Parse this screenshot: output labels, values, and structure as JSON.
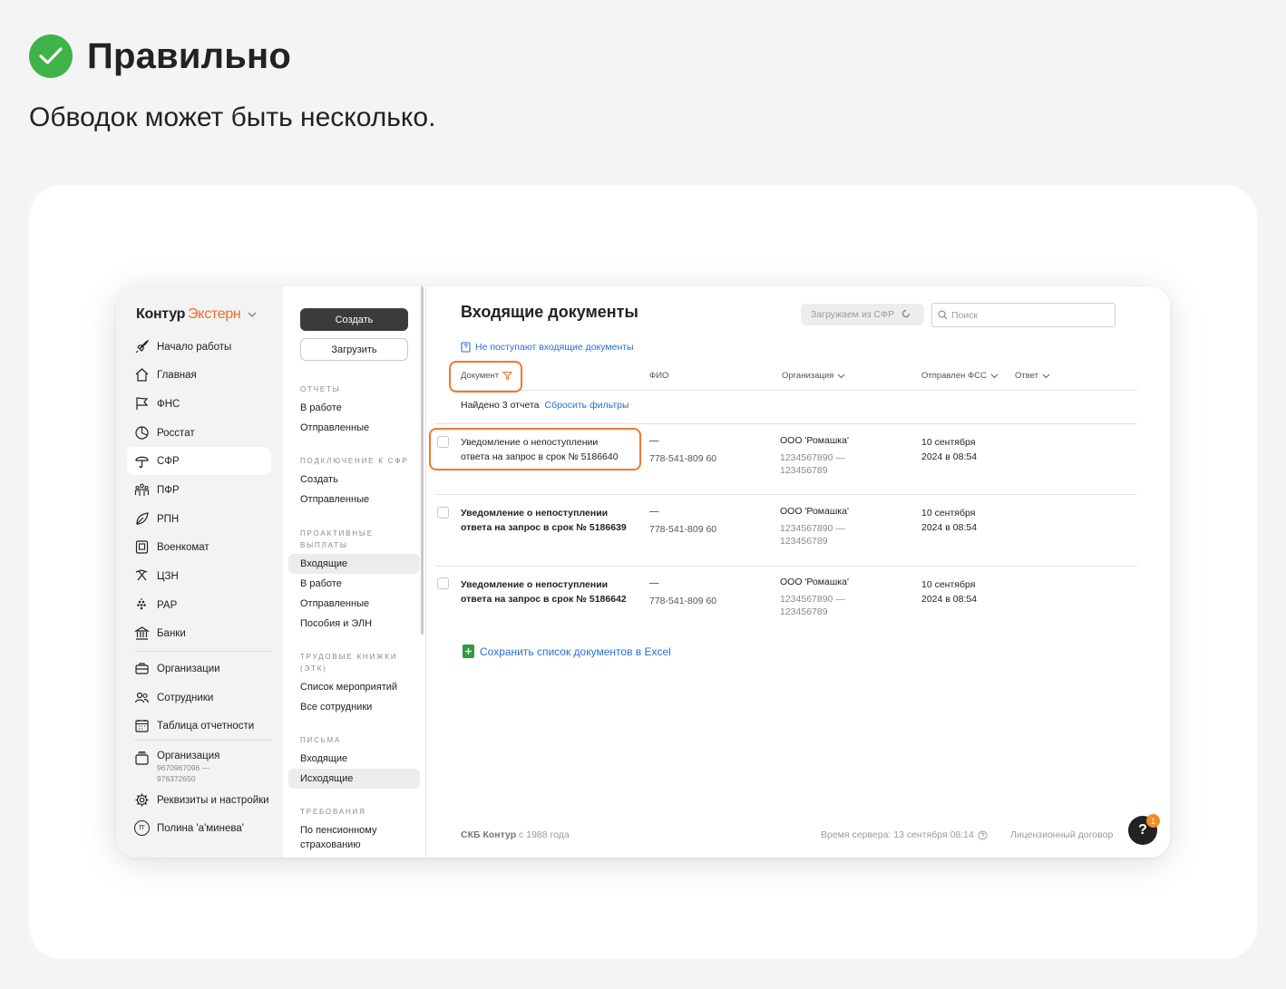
{
  "slide": {
    "title": "Правильно",
    "subtitle": "Обводок может быть несколько."
  },
  "brand": {
    "part1": "Контур",
    "part2": "Экстерн"
  },
  "nav": {
    "items": [
      {
        "label": "Начало работы",
        "icon": "rocket-icon"
      },
      {
        "label": "Главная",
        "icon": "home-icon"
      },
      {
        "label": "ФНС",
        "icon": "flag-icon"
      },
      {
        "label": "Росстат",
        "icon": "pie-chart-icon"
      },
      {
        "label": "СФР",
        "icon": "umbrella-icon"
      },
      {
        "label": "ПФР",
        "icon": "people-icon"
      },
      {
        "label": "РПН",
        "icon": "leaf-icon"
      },
      {
        "label": "Военкомат",
        "icon": "badge-icon"
      },
      {
        "label": "ЦЗН",
        "icon": "tools-icon"
      },
      {
        "label": "РАР",
        "icon": "grapes-icon"
      },
      {
        "label": "Банки",
        "icon": "bank-icon"
      }
    ],
    "items2": [
      {
        "label": "Организации",
        "icon": "briefcase-icon"
      },
      {
        "label": "Сотрудники",
        "icon": "users-icon"
      },
      {
        "label": "Таблица отчетности",
        "icon": "calendar-icon"
      }
    ],
    "org": {
      "name": "Организация",
      "inn": "9670967096 —",
      "kpp": "976372650"
    },
    "settings": "Реквизиты и настройки",
    "user": "Полина 'а'минева'",
    "user_initial": "П'"
  },
  "subnav": {
    "create": "Создать",
    "upload": "Загрузить",
    "sections": [
      {
        "head": "Отчеты",
        "items": [
          "В работе",
          "Отправленные"
        ]
      },
      {
        "head": "Подключение к СФР",
        "items": [
          "Создать",
          "Отправленные"
        ]
      },
      {
        "head": "Проактивные выплаты",
        "items": [
          "Входящие",
          "В работе",
          "Отправленные",
          "Пособия и ЭЛН"
        ]
      },
      {
        "head": "Трудовые книжки (ЭТК)",
        "items": [
          "Список мероприятий",
          "Все сотрудники"
        ]
      },
      {
        "head": "Письма",
        "items": [
          "Входящие",
          "Исходящие"
        ]
      },
      {
        "head": "Требования",
        "items": [
          "По пенсионному страхованию"
        ]
      }
    ]
  },
  "main": {
    "title": "Входящие документы",
    "load_btn": "Загружаем из СФР",
    "search_placeholder": "Поиск",
    "link": "Не поступают входящие документы",
    "columns": [
      "Документ",
      "ФИО",
      "Организация",
      "Отправлен ФСС",
      "Ответ"
    ],
    "found": "Найдено 3 отчета",
    "reset": "Сбросить фильтры",
    "rows": [
      {
        "doc1": "Уведомление о непоступлении",
        "doc2": "ответа на запрос в срок № 5186640",
        "fio_dash": "—",
        "fio_num": "778-541-809 60",
        "org": "ООО 'Ромашка'",
        "org_inn": "1234567890 —",
        "org_kpp": "123456789",
        "sent1": "10 сентября",
        "sent2": "2024 в 08:54"
      },
      {
        "doc1": "Уведомление о непоступлении",
        "doc2": "ответа на запрос в срок № 5186639",
        "fio_dash": "—",
        "fio_num": "778-541-809 60",
        "org": "ООО 'Ромашка'",
        "org_inn": "1234567890 —",
        "org_kpp": "123456789",
        "sent1": "10 сентября",
        "sent2": "2024 в 08:54"
      },
      {
        "doc1": "Уведомление о непоступлении",
        "doc2": "ответа на запрос в срок № 5186642",
        "fio_dash": "—",
        "fio_num": "778-541-809 60",
        "org": "ООО 'Ромашка'",
        "org_inn": "1234567890 —",
        "org_kpp": "123456789",
        "sent1": "10 сентября",
        "sent2": "2024 в 08:54"
      }
    ],
    "excel": "Сохранить список документов в Excel",
    "footer_brand": "СКБ Контур",
    "footer_since": " с 1988 года",
    "footer_time": "Время сервера: 13 сентября 08:14",
    "footer_license": "Лицензионный договор",
    "help": "?",
    "help_badge": "1"
  },
  "colors": {
    "accent": "#f2772e",
    "link": "#2a6fce",
    "success": "#3fb24a"
  }
}
